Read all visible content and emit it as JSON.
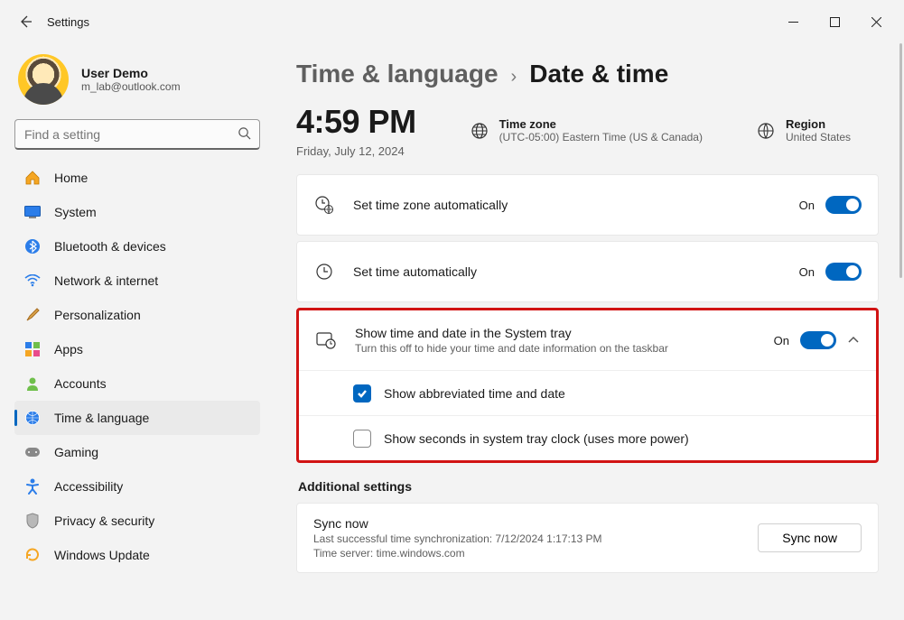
{
  "window": {
    "title": "Settings"
  },
  "user": {
    "name": "User Demo",
    "email": "m_lab@outlook.com"
  },
  "search": {
    "placeholder": "Find a setting"
  },
  "nav": [
    {
      "key": "home",
      "label": "Home"
    },
    {
      "key": "system",
      "label": "System"
    },
    {
      "key": "bluetooth",
      "label": "Bluetooth & devices"
    },
    {
      "key": "network",
      "label": "Network & internet"
    },
    {
      "key": "personalization",
      "label": "Personalization"
    },
    {
      "key": "apps",
      "label": "Apps"
    },
    {
      "key": "accounts",
      "label": "Accounts"
    },
    {
      "key": "time",
      "label": "Time & language",
      "selected": true
    },
    {
      "key": "gaming",
      "label": "Gaming"
    },
    {
      "key": "accessibility",
      "label": "Accessibility"
    },
    {
      "key": "privacy",
      "label": "Privacy & security"
    },
    {
      "key": "update",
      "label": "Windows Update"
    }
  ],
  "breadcrumb": {
    "parent": "Time & language",
    "current": "Date & time"
  },
  "clock": {
    "time": "4:59 PM",
    "date": "Friday, July 12, 2024"
  },
  "timezone": {
    "label": "Time zone",
    "value": "(UTC-05:00) Eastern Time (US & Canada)"
  },
  "region": {
    "label": "Region",
    "value": "United States"
  },
  "rows": {
    "auto_tz": {
      "label": "Set time zone automatically",
      "state": "On"
    },
    "auto_time": {
      "label": "Set time automatically",
      "state": "On"
    },
    "systray": {
      "label": "Show time and date in the System tray",
      "sub": "Turn this off to hide your time and date information on the taskbar",
      "state": "On",
      "opt_abbrev": "Show abbreviated time and date",
      "opt_seconds": "Show seconds in system tray clock (uses more power)"
    }
  },
  "additional": {
    "heading": "Additional settings",
    "sync": {
      "title": "Sync now",
      "line1": "Last successful time synchronization: 7/12/2024 1:17:13 PM",
      "line2": "Time server: time.windows.com",
      "button": "Sync now"
    }
  }
}
